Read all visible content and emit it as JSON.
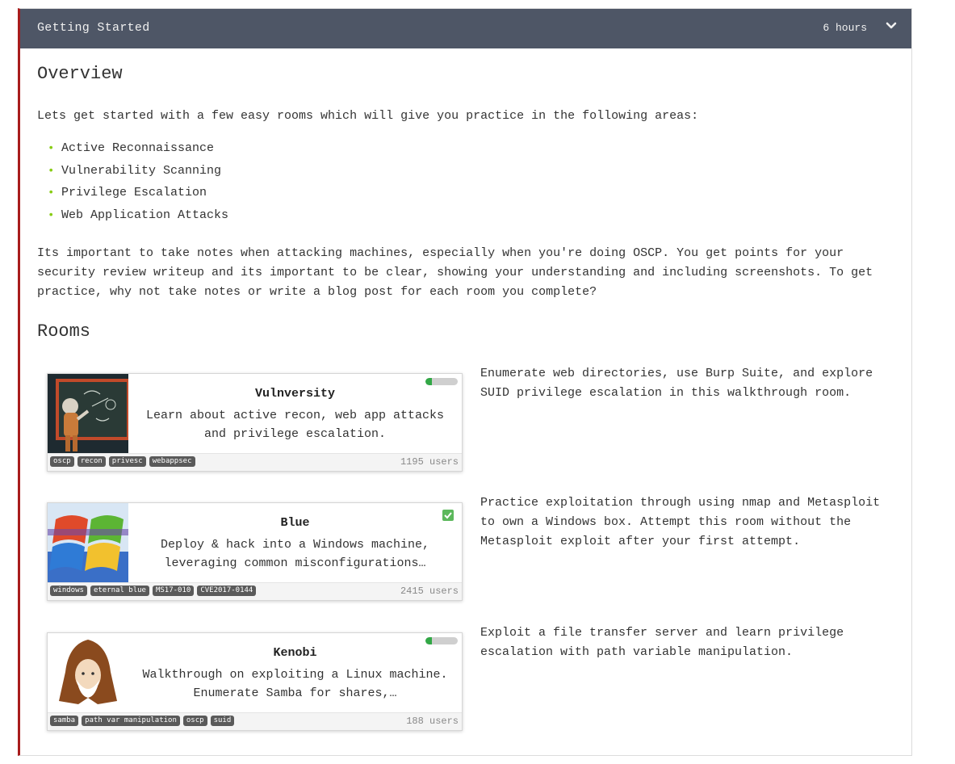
{
  "section": {
    "title": "Getting Started",
    "duration": "6 hours"
  },
  "overview": {
    "heading": "Overview",
    "intro": "Lets get started with a few easy rooms which will give you practice in the following areas:",
    "areas": [
      "Active Reconnaissance",
      "Vulnerability Scanning",
      "Privilege Escalation",
      "Web Application Attacks"
    ],
    "notes": "Its important to take notes when attacking machines, especially when you're doing OSCP. You get points for your security review writeup and its important to be clear, showing your understanding and including screenshots. To get practice, why not take notes or write a blog post for each room you complete?"
  },
  "rooms": {
    "heading": "Rooms",
    "items": [
      {
        "title": "Vulnversity",
        "description": "Learn about active recon, web app attacks and privilege escalation.",
        "tags": [
          "oscp",
          "recon",
          "privesc",
          "webappsec"
        ],
        "users": "1195 users",
        "status": "in-progress",
        "progress_percent": 20,
        "icon": "astronaut-chalkboard-icon",
        "blurb": "Enumerate web directories, use Burp Suite, and explore SUID privilege escalation in this walkthrough room."
      },
      {
        "title": "Blue",
        "description": "Deploy & hack into a Windows machine, leveraging common misconfigurations…",
        "tags": [
          "windows",
          "eternal blue",
          "MS17-010",
          "CVE2017-0144"
        ],
        "users": "2415 users",
        "status": "completed",
        "icon": "windows-logo-icon",
        "blurb": "Practice exploitation through using nmap and Metasploit to own a Windows box. Attempt this room without the Metasploit exploit after your first attempt."
      },
      {
        "title": "Kenobi",
        "description": "Walkthrough on exploiting a Linux machine. Enumerate Samba for shares,…",
        "tags": [
          "samba",
          "path var manipulation",
          "oscp",
          "suid"
        ],
        "users": "188 users",
        "status": "in-progress",
        "progress_percent": 20,
        "icon": "hooded-jedi-icon",
        "blurb": "Exploit a file transfer server and learn privilege escalation with path variable manipulation."
      }
    ]
  },
  "colors": {
    "header_bg": "#4e5666",
    "accent_border": "#a81c1c",
    "bullet": "#88cc14",
    "progress": "#32a846",
    "check": "#5cb85c"
  }
}
